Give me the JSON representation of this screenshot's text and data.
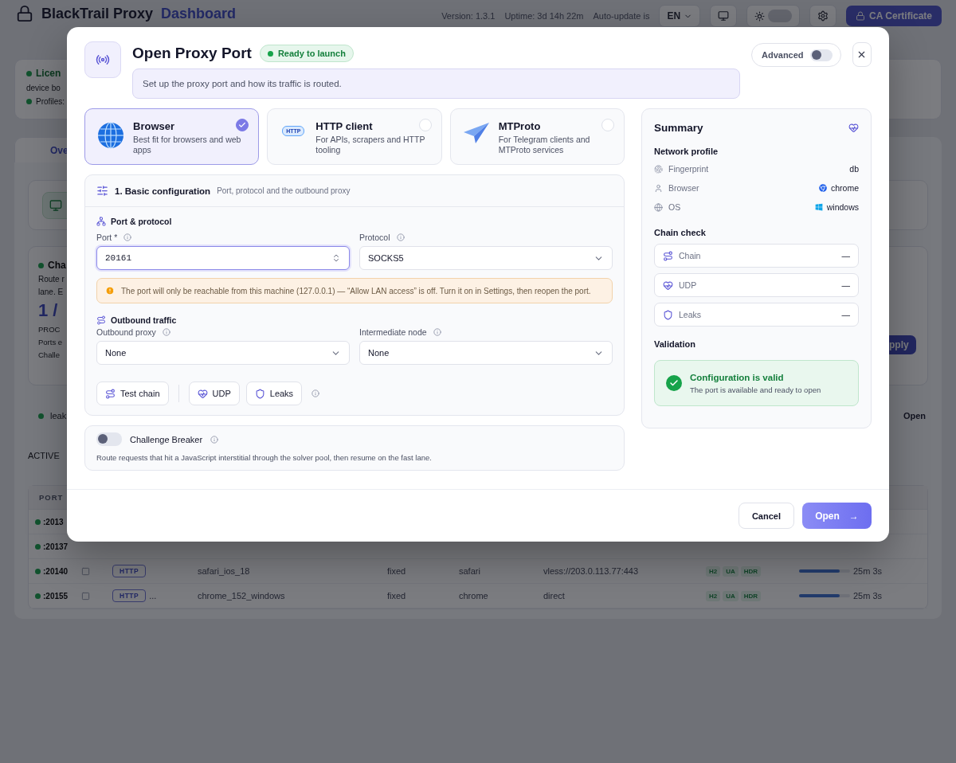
{
  "header": {
    "title": "BlackTrail Proxy",
    "subtitle": "Dashboard",
    "version": "Version: 1.3.1",
    "uptime": "Uptime: 3d 14h 22m",
    "auto_update": "Auto-update is",
    "language": "EN",
    "ca_button": "CA Certificate",
    "theme_on": false
  },
  "background": {
    "license": "Licen",
    "device": "device bo",
    "profiles": "Profiles:",
    "tab": "Ove",
    "challenge": {
      "title": "Cha",
      "line1": "Route r",
      "line2": "lane. E",
      "count": "1 /",
      "caption": "PROC",
      "row1": "Ports e",
      "row2": "Challe",
      "apply": "pply"
    },
    "leaks": {
      "label": "leak",
      "action": "Open"
    },
    "active_heading": "ACTIVE"
  },
  "table": {
    "columns": [
      "PORT"
    ],
    "rows": [
      {
        "kind": "partial",
        "port": ":2013"
      },
      {
        "kind": "partial",
        "port": ":20137"
      },
      {
        "kind": "full",
        "port": ":20140",
        "checked": false,
        "protocol": "HTTP",
        "profile": "safari_ios_18",
        "mode": "fixed",
        "browser": "safari",
        "upstream": "vless://203.0.113.77:443",
        "flags": [
          "H2",
          "UA",
          "HDR"
        ],
        "level": 0.8,
        "time": "25m 3s"
      },
      {
        "kind": "full",
        "port": ":20155",
        "checked": false,
        "protocol": "HTTP",
        "extra": "...",
        "profile": "chrome_152_windows",
        "mode": "fixed",
        "browser": "chrome",
        "upstream": "direct",
        "flags": [
          "H2",
          "UA",
          "HDR"
        ],
        "level": 0.8,
        "time": "25m 3s"
      }
    ]
  },
  "dialog": {
    "title": "Open Proxy Port",
    "status": "Ready to launch",
    "advanced": {
      "label": "Advanced",
      "on": false
    },
    "description": "Set up the proxy port and how its traffic is routed.",
    "modes": [
      {
        "kind": "globe",
        "title": "Browser",
        "description": "Best fit for browsers and web apps",
        "selected": true
      },
      {
        "kind": "http",
        "badge": "HTTP",
        "title": "HTTP client",
        "description": "For APIs, scrapers and HTTP tooling",
        "selected": false
      },
      {
        "kind": "plane",
        "title": "MTProto",
        "description": "For Telegram clients and MTProto services",
        "selected": false
      }
    ],
    "basic": {
      "title": "1. Basic configuration",
      "subtitle": "Port, protocol and the outbound proxy",
      "port_section": "Port & protocol",
      "port": {
        "label": "Port *",
        "value": "20161"
      },
      "protocol": {
        "label": "Protocol",
        "value": "SOCKS5"
      },
      "warning": "The port will only be reachable from this machine (127.0.0.1) — “Allow LAN access” is off. Turn it on in Settings, then reopen the port.",
      "outbound_section": "Outbound traffic",
      "outbound_proxy": {
        "label": "Outbound proxy",
        "value": "None"
      },
      "intermediate": {
        "label": "Intermediate node",
        "value": "None"
      },
      "actions": [
        {
          "kind": "chain",
          "label": "Test chain"
        },
        {
          "kind": "udp",
          "label": "UDP"
        },
        {
          "kind": "leaks",
          "label": "Leaks"
        }
      ]
    },
    "challenge": {
      "label": "Challenge Breaker",
      "on": false,
      "description": "Route requests that hit a JavaScript interstitial through the solver pool, then resume on the fast lane."
    },
    "summary": {
      "title": "Summary",
      "network_heading": "Network profile",
      "network": [
        {
          "kind": "fingerprint",
          "label": "Fingerprint",
          "value": "db"
        },
        {
          "kind": "browser",
          "label": "Browser",
          "value": "chrome"
        },
        {
          "kind": "os",
          "label": "OS",
          "value": "windows"
        }
      ],
      "chain_heading": "Chain check",
      "checks": [
        {
          "kind": "chain",
          "label": "Chain",
          "value": "—"
        },
        {
          "kind": "udp",
          "label": "UDP",
          "value": "—"
        },
        {
          "kind": "leaks",
          "label": "Leaks",
          "value": "—"
        }
      ],
      "validation_heading": "Validation",
      "validation": {
        "valid": true,
        "title": "Configuration is valid",
        "message": "The port is available and ready to open"
      }
    },
    "buttons": {
      "cancel": "Cancel",
      "open": "Open",
      "open_arrow": "→"
    }
  }
}
